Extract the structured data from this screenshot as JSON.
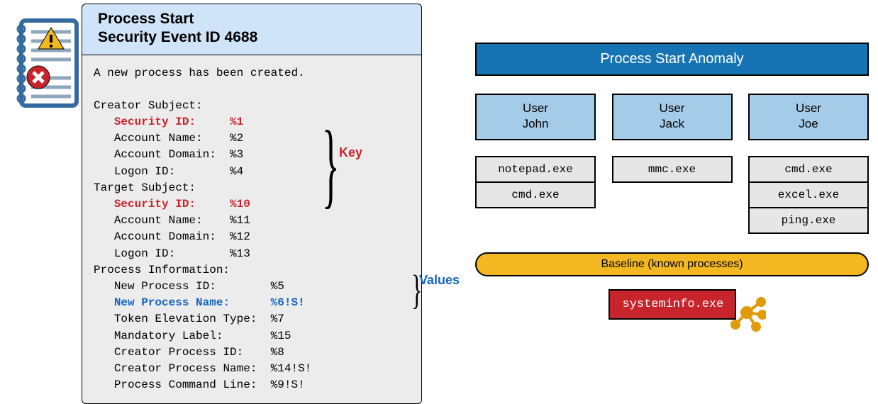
{
  "event": {
    "title_line1": "Process Start",
    "title_line2": "Security Event ID 4688",
    "intro": "A new process has been created.",
    "creator_heading": "Creator Subject:",
    "target_heading": "Target Subject:",
    "procinfo_heading": "Process Information:",
    "creator": {
      "security_id": {
        "label": "Security ID:",
        "value": "%1"
      },
      "account_name": {
        "label": "Account Name:",
        "value": "%2"
      },
      "account_domain": {
        "label": "Account Domain:",
        "value": "%3"
      },
      "logon_id": {
        "label": "Logon ID:",
        "value": "%4"
      }
    },
    "target": {
      "security_id": {
        "label": "Security ID:",
        "value": "%10"
      },
      "account_name": {
        "label": "Account Name:",
        "value": "%11"
      },
      "account_domain": {
        "label": "Account Domain:",
        "value": "%12"
      },
      "logon_id": {
        "label": "Logon ID:",
        "value": "%13"
      }
    },
    "procinfo": {
      "new_pid": {
        "label": "New Process ID:",
        "value": "%5"
      },
      "new_pname": {
        "label": "New Process Name:",
        "value": "%6!S!"
      },
      "token_elev": {
        "label": "Token Elevation Type:",
        "value": "%7"
      },
      "mandatory": {
        "label": "Mandatory Label:",
        "value": "%15"
      },
      "creator_pid": {
        "label": "Creator Process ID:",
        "value": "%8"
      },
      "creator_pname": {
        "label": "Creator Process Name:",
        "value": "%14!S!"
      },
      "cmdline": {
        "label": "Process Command Line:",
        "value": "%9!S!"
      }
    },
    "key_label": "Key",
    "values_label": "Values"
  },
  "anomaly": {
    "title": "Process Start Anomaly",
    "users": [
      {
        "prefix": "User",
        "name": "John",
        "processes": [
          "notepad.exe",
          "cmd.exe"
        ]
      },
      {
        "prefix": "User",
        "name": "Jack",
        "processes": [
          "mmc.exe"
        ]
      },
      {
        "prefix": "User",
        "name": "Joe",
        "processes": [
          "cmd.exe",
          "excel.exe",
          "ping.exe"
        ]
      }
    ],
    "baseline_label": "Baseline (known processes)",
    "flagged_process": "systeminfo.exe"
  },
  "colors": {
    "key_highlight": "#c7242c",
    "value_highlight": "#1565c0",
    "header_bg": "#cfe4f8",
    "title_bar": "#1774b4",
    "user_bg": "#a4cbe8",
    "baseline_bg": "#f3b821",
    "flagged_bg": "#c7242c"
  }
}
